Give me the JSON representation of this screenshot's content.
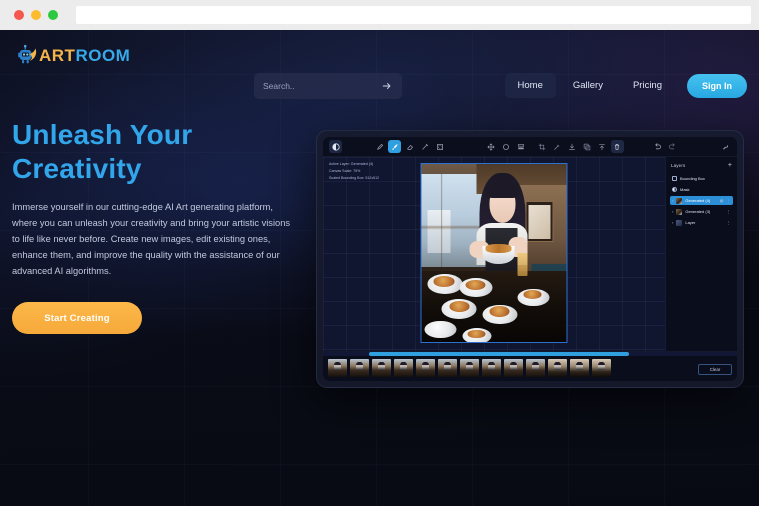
{
  "browser": {
    "dots": [
      "red",
      "yellow",
      "green"
    ],
    "url_value": ""
  },
  "brand": {
    "name_part1": "ART",
    "name_part2": "ROOM",
    "mark_icon": "robot-mascot-icon",
    "color_part1": "#f3b44a",
    "color_part2": "#37a9e8"
  },
  "search": {
    "placeholder": "Search..",
    "value": "",
    "submit_icon": "arrow-right-icon"
  },
  "nav": {
    "items": [
      {
        "label": "Home",
        "active": true
      },
      {
        "label": "Gallery",
        "active": false
      },
      {
        "label": "Pricing",
        "active": false
      }
    ],
    "signin_label": "Sign In"
  },
  "hero": {
    "title_line1": "Unleash Your",
    "title_line2": "Creativity",
    "description": "Immerse yourself in our cutting-edge AI Art generating platform, where you can unleash your creativity and bring your artistic visions to life like never before. Create new images, edit existing ones, enhance them, and improve the quality with the assistance of our advanced AI algorithms.",
    "cta_label": "Start Creating",
    "title_color": "#32a6ea",
    "cta_color": "#f6a93a"
  },
  "app": {
    "toolbar": {
      "mode_icon": "contrast-circle-icon",
      "tools": [
        {
          "icon": "pencil-icon",
          "active": false
        },
        {
          "icon": "brush-icon",
          "active": true
        },
        {
          "icon": "eraser-icon",
          "active": false
        },
        {
          "icon": "pen-icon",
          "active": false
        },
        {
          "icon": "bounding-box-icon",
          "active": false
        }
      ],
      "transform": [
        {
          "icon": "move-icon"
        },
        {
          "icon": "reset-circle-icon"
        },
        {
          "icon": "merge-layers-icon"
        }
      ],
      "actions": [
        {
          "icon": "crop-icon"
        },
        {
          "icon": "eyedropper-icon"
        },
        {
          "icon": "download-icon"
        },
        {
          "icon": "copy-icon"
        },
        {
          "icon": "upload-icon"
        },
        {
          "icon": "trash-icon",
          "boxed": true
        }
      ],
      "history": [
        {
          "icon": "undo-icon"
        },
        {
          "icon": "redo-icon"
        }
      ],
      "settings_icon": "wrench-icon"
    },
    "canvas": {
      "info_lines": [
        "Active Layer: Generated (4)",
        "Canvas Scale: 75%",
        "Scaled Bounding Box: 512x512"
      ],
      "image_alt": "anime-girl-eating-noodles-restaurant"
    },
    "layers": {
      "title": "Layers",
      "add_icon": "plus-icon",
      "items": [
        {
          "label": "Bounding Box",
          "marker": "checkbox",
          "selected": false
        },
        {
          "label": "Mask",
          "marker": "half-circle",
          "selected": false
        },
        {
          "label": "Generated (4)",
          "marker": "thumbnail",
          "selected": true
        },
        {
          "label": "Generated (3)",
          "marker": "thumbnail",
          "selected": false
        },
        {
          "label": "Layer",
          "marker": "thumbnail-plain",
          "selected": false
        }
      ]
    },
    "filmstrip": {
      "progress_percent": 63,
      "thumbnail_count": 13,
      "clear_label": "Clear"
    }
  }
}
